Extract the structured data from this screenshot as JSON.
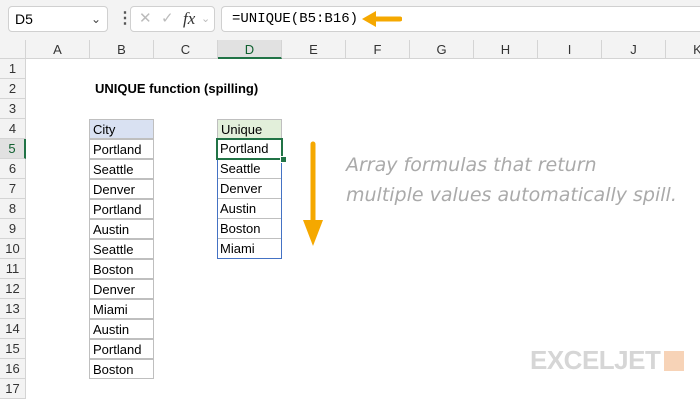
{
  "formula_bar": {
    "name_box": "D5",
    "formula": "=UNIQUE(B5:B16)",
    "fx": "fx"
  },
  "columns": [
    "A",
    "B",
    "C",
    "D",
    "E",
    "F",
    "G",
    "H",
    "I",
    "J",
    "K"
  ],
  "rows": [
    "1",
    "2",
    "3",
    "4",
    "5",
    "6",
    "7",
    "8",
    "9",
    "10",
    "11",
    "12",
    "13",
    "14",
    "15",
    "16",
    "17"
  ],
  "title": "UNIQUE function (spilling)",
  "city_header": "City",
  "cities": [
    "Portland",
    "Seattle",
    "Denver",
    "Portland",
    "Austin",
    "Seattle",
    "Boston",
    "Denver",
    "Miami",
    "Austin",
    "Portland",
    "Boston"
  ],
  "unique_header": "Unique",
  "unique": [
    "Portland",
    "Seattle",
    "Denver",
    "Austin",
    "Boston",
    "Miami"
  ],
  "note": {
    "line1": "Array formulas that return",
    "line2": "multiple values automatically spill."
  },
  "logo": "EXCELJET",
  "colors": {
    "accent_arrow": "#f5a800",
    "selection": "#217346",
    "spill_border": "#4472c4",
    "header_fill_city": "#d9e1f2",
    "header_fill_unique": "#e2efda"
  }
}
